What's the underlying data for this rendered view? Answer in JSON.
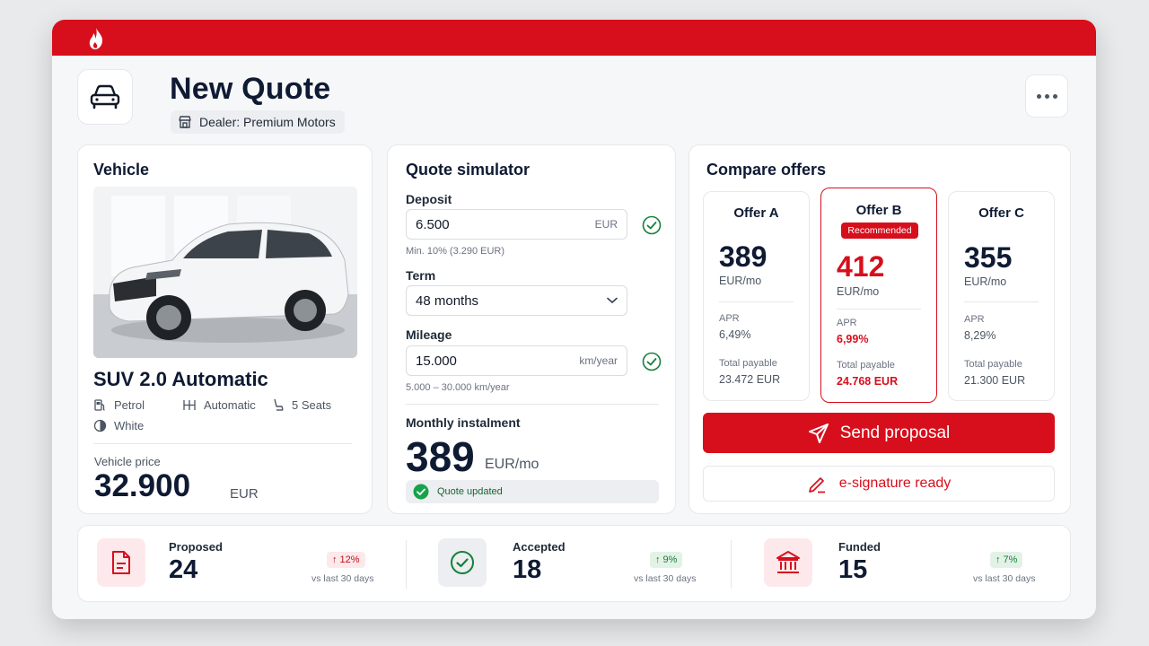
{
  "app": {
    "title": "New Quote",
    "dealer": "Dealer: Premium Motors",
    "brand_color": "#d70f1c"
  },
  "vehicle": {
    "heading": "Vehicle",
    "model": "SUV 2.0 Automatic",
    "specs": {
      "fuel": "Petrol",
      "transmission": "Automatic",
      "seats": "5 Seats",
      "color": "White"
    },
    "price_label": "Vehicle price",
    "price": "32.900",
    "price_unit": "EUR"
  },
  "simulator": {
    "heading": "Quote simulator",
    "deposit": {
      "label": "Deposit",
      "value": "6.500",
      "unit": "EUR",
      "hint": "Min. 10% (3.290 EUR)"
    },
    "term": {
      "label": "Term",
      "value": "48 months"
    },
    "mileage": {
      "label": "Mileage",
      "value": "15.000",
      "unit": "km/year",
      "hint": "5.000 – 30.000 km/year"
    },
    "instalment_label": "Monthly instalment",
    "instalment_value": "389",
    "instalment_unit": "EUR/mo",
    "status": "Quote updated"
  },
  "compare": {
    "heading": "Compare offers",
    "recommended_label": "Recommended",
    "apr_label": "APR",
    "total_label": "Total payable",
    "offers": [
      {
        "name": "Offer A",
        "amount": "389",
        "unit": "EUR/mo",
        "apr": "6,49%",
        "total": "23.472 EUR"
      },
      {
        "name": "Offer B",
        "amount": "412",
        "unit": "EUR/mo",
        "apr": "6,99%",
        "total": "24.768 EUR"
      },
      {
        "name": "Offer C",
        "amount": "355",
        "unit": "EUR/mo",
        "apr": "8,29%",
        "total": "21.300 EUR"
      }
    ],
    "send_label": "Send proposal",
    "esign_label": "e-signature ready"
  },
  "stats": {
    "comparison_note": "vs last 30 days",
    "items": [
      {
        "label": "Proposed",
        "value": "24",
        "trend": "12%",
        "icon": "document-icon"
      },
      {
        "label": "Accepted",
        "value": "18",
        "trend": "9%",
        "icon": "check-circle-icon"
      },
      {
        "label": "Funded",
        "value": "15",
        "trend": "7%",
        "icon": "bank-icon"
      }
    ]
  }
}
